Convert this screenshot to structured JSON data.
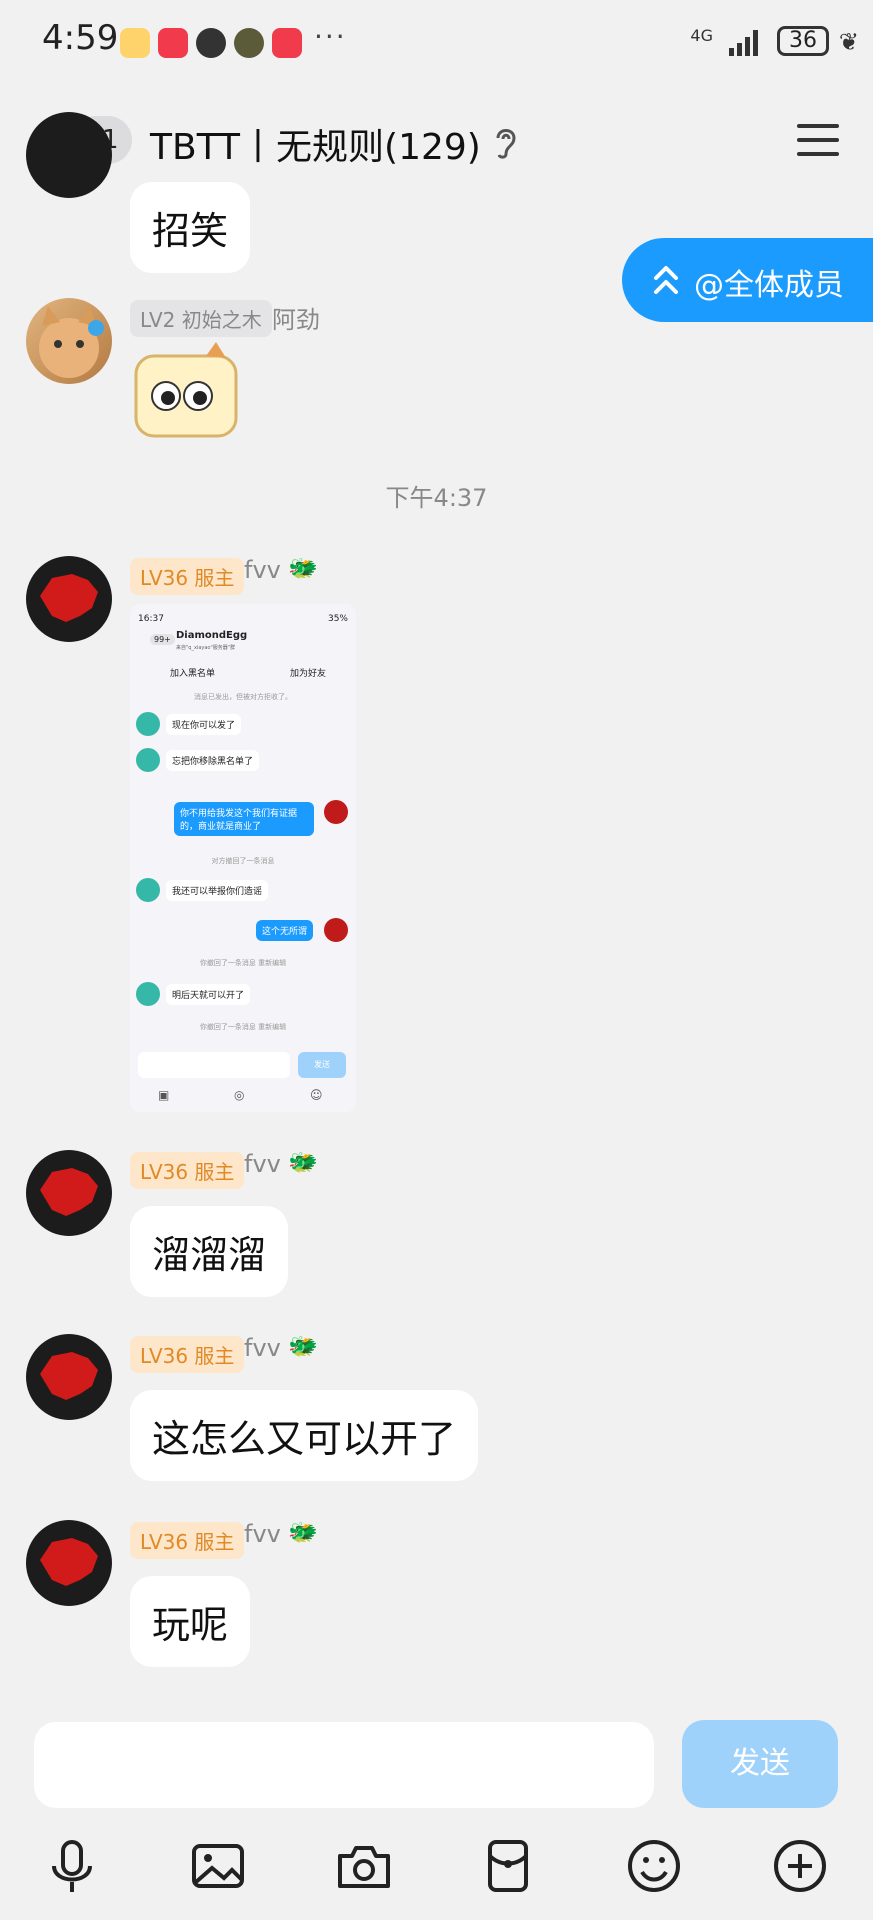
{
  "status": {
    "time": "4:59",
    "network": "4G",
    "battery": "36",
    "more": "···"
  },
  "header": {
    "back_badge": "11",
    "title": "TBTT丨无规则(129)"
  },
  "mention_button": "@全体成员",
  "messages": [
    {
      "type": "text",
      "text": "招笑"
    },
    {
      "type": "sticker",
      "level": "LV2 初始之木",
      "nick": "阿劲"
    },
    {
      "type": "time",
      "text": "下午4:37"
    },
    {
      "type": "image",
      "level": "LV36 服主",
      "nick": "fvv"
    },
    {
      "type": "text",
      "level": "LV36 服主",
      "nick": "fvv",
      "text": "溜溜溜"
    },
    {
      "type": "text",
      "level": "LV36 服主",
      "nick": "fvv",
      "text": "这怎么又可以开了"
    },
    {
      "type": "text",
      "level": "LV36 服主",
      "nick": "fvv",
      "text": "玩呢"
    }
  ],
  "screenshot": {
    "time": "16:37",
    "battery": "35%",
    "badge": "99+",
    "title": "DiamondEgg",
    "subtitle": "来自\"q_xiayao\"服务器\"群",
    "blacklist": "加入黑名单",
    "add_friend": "加为好友",
    "sys1": "消息已发出，但被对方拒收了。",
    "m1": "现在你可以发了",
    "m2": "忘把你移除黑名单了",
    "m3": "你不用给我发这个我们有证据的，商业就是商业了",
    "sys2": "对方撤回了一条消息",
    "m4": "我还可以举报你们造谣",
    "m5": "这个无所谓",
    "sys3": "你撤回了一条消息 重新编辑",
    "m6": "明后天就可以开了",
    "sys4": "你撤回了一条消息 重新编辑",
    "send": "发送"
  },
  "input": {
    "send_label": "发送"
  },
  "toolbar": [
    "microphone-icon",
    "image-icon",
    "camera-icon",
    "red-packet-icon",
    "emoji-icon",
    "plus-icon"
  ]
}
